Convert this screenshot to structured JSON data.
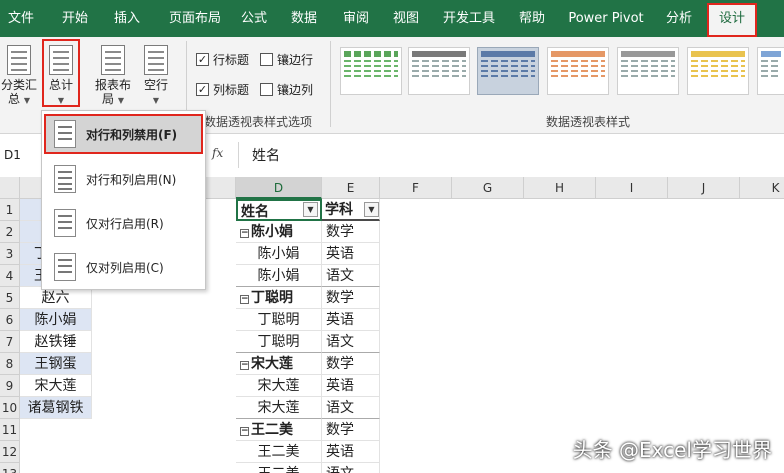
{
  "tabs": [
    "文件",
    "开始",
    "插入",
    "页面布局",
    "公式",
    "数据",
    "审阅",
    "视图",
    "开发工具",
    "帮助",
    "Power Pivot",
    "分析",
    "设计"
  ],
  "ribbon": {
    "subtotal_label": "分类汇总",
    "subtotal_line1": "分类汇",
    "subtotal_line2": "总",
    "grandtotal_label": "总计",
    "report_layout_line1": "报表布",
    "report_layout_line2": "局",
    "blank_rows_label": "空行",
    "chk_row_headers": "行标题",
    "chk_banded_rows": "镶边行",
    "chk_col_headers": "列标题",
    "chk_banded_cols": "镶边列",
    "group_options": "数据透视表样式选项",
    "group_styles": "数据透视表样式"
  },
  "formula_bar": {
    "name_box": "D1",
    "fx": "fx",
    "value": "姓名"
  },
  "columns": [
    "D",
    "E",
    "F",
    "G",
    "H",
    "I",
    "J",
    "K"
  ],
  "rows": [
    "1",
    "2",
    "3",
    "4",
    "5",
    "6",
    "7",
    "8",
    "9",
    "10",
    "11",
    "12",
    "13"
  ],
  "col_a_values": [
    "",
    "",
    "丁",
    "王",
    "赵六",
    "陈小娟",
    "赵铁锤",
    "王钢蛋",
    "宋大莲",
    "诸葛钢铁",
    "",
    "",
    ""
  ],
  "pivot": {
    "header_name": "姓名",
    "header_subject": "学科",
    "rows": [
      {
        "name": "陈小娟",
        "subject": "数学",
        "group": true
      },
      {
        "name": "陈小娟",
        "subject": "英语",
        "group": false
      },
      {
        "name": "陈小娟",
        "subject": "语文",
        "group": false
      },
      {
        "name": "丁聪明",
        "subject": "数学",
        "group": true
      },
      {
        "name": "丁聪明",
        "subject": "英语",
        "group": false
      },
      {
        "name": "丁聪明",
        "subject": "语文",
        "group": false
      },
      {
        "name": "宋大莲",
        "subject": "数学",
        "group": true
      },
      {
        "name": "宋大莲",
        "subject": "英语",
        "group": false
      },
      {
        "name": "宋大莲",
        "subject": "语文",
        "group": false
      },
      {
        "name": "王二美",
        "subject": "数学",
        "group": true
      },
      {
        "name": "王二美",
        "subject": "英语",
        "group": false
      },
      {
        "name": "王二美",
        "subject": "语文",
        "group": false
      }
    ]
  },
  "menu": {
    "item1": "对行和列禁用(F)",
    "item2": "对行和列启用(N)",
    "item3": "仅对行启用(R)",
    "item4": "仅对列启用(C)"
  },
  "watermark": "头条 @Excel学习世界"
}
